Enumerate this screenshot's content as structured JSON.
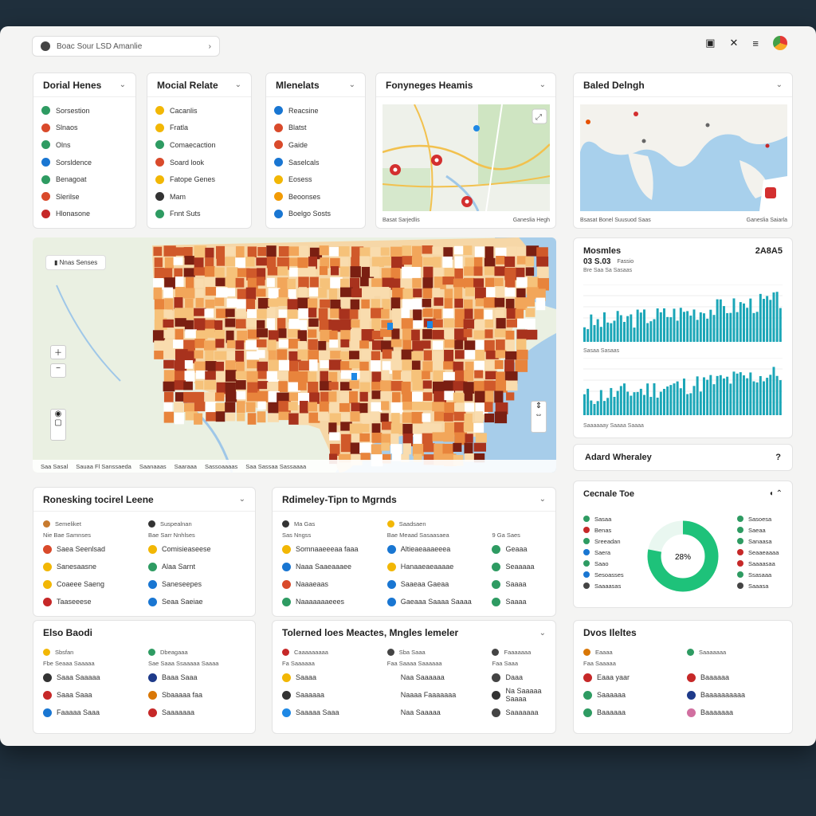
{
  "toolbar": {
    "search_value": "Boac Sour LSD Amanlie"
  },
  "cards": {
    "c1": {
      "title": "Dorial Henes",
      "items": [
        {
          "label": "Sorsestion",
          "color": "#2e9b62"
        },
        {
          "label": "Slnaos",
          "color": "#d94a2b"
        },
        {
          "label": "Olns",
          "color": "#2e9b62"
        },
        {
          "label": "Sorsldence",
          "color": "#1976d2"
        },
        {
          "label": "Benagoat",
          "color": "#2e9b62"
        },
        {
          "label": "Slerilse",
          "color": "#d94a2b"
        },
        {
          "label": "Hlonasone",
          "color": "#c62828"
        }
      ]
    },
    "c2": {
      "title": "Mocial Relate",
      "items": [
        {
          "label": "Cacanlis",
          "color": "#f2b705"
        },
        {
          "label": "Fratla",
          "color": "#f2b705"
        },
        {
          "label": "Comaecaction",
          "color": "#2e9b62"
        },
        {
          "label": "Soard look",
          "color": "#d94a2b"
        },
        {
          "label": "Fatope Genes",
          "color": "#f2b705"
        },
        {
          "label": "Mam",
          "color": "#333"
        },
        {
          "label": "Fnnt Suts",
          "color": "#2e9b62"
        }
      ]
    },
    "c3": {
      "title": "Mlenelats",
      "items": [
        {
          "label": "Reacsine",
          "color": "#1976d2"
        },
        {
          "label": "Blatst",
          "color": "#d94a2b"
        },
        {
          "label": "Gaide",
          "color": "#d94a2b"
        },
        {
          "label": "Saselcals",
          "color": "#1976d2"
        },
        {
          "label": "Eosess",
          "color": "#f2b705"
        },
        {
          "label": "Beoonses",
          "color": "#f29b05"
        },
        {
          "label": "Boelgo Sosts",
          "color": "#1976d2"
        }
      ]
    },
    "c4": {
      "title": "Fonyneges Heamis",
      "footer": "Basat Sarjedlis",
      "footer2": "Ganeslia Hegh"
    },
    "c5": {
      "title": "Baled Delngh",
      "footer": "Bsasat Bonel Suusuod Saas",
      "footer2": "Ganeslia Saiarla"
    }
  },
  "bigmap": {
    "label": "Nnas Senses",
    "footer": [
      "Saa Sasal",
      "Sauaa Fl Sanssaeda",
      "Saanaaas",
      "Saaraaa",
      "Sassoaaaas",
      "Saa Sassaa Sassaaaa"
    ]
  },
  "stats": {
    "title": "Mosmles",
    "value": "2A8A5",
    "sub_value": "03 S.03",
    "sub_label": "Fassio",
    "caption": "Bre Saa Sa Sasaas",
    "caption2": "Sasaa Sasaas",
    "caption3": "Saaaaaay Saaaa Saaaa"
  },
  "alert": {
    "title": "Adard Wheraley",
    "icon": "?"
  },
  "donut": {
    "title": "Cecnale Toe",
    "center": "28%",
    "percent": 0.78,
    "color": "#1ec27a",
    "left": [
      {
        "label": "Sasaa",
        "color": "#2e9b62"
      },
      {
        "label": "Benas",
        "color": "#c62828"
      },
      {
        "label": "Sreeadan",
        "color": "#2e9b62"
      },
      {
        "label": "Saera",
        "color": "#1976d2"
      },
      {
        "label": "Saao",
        "color": "#2e9b62"
      },
      {
        "label": "Sesoasses",
        "color": "#1976d2"
      },
      {
        "label": "Saaaasas",
        "color": "#444"
      }
    ],
    "right": [
      {
        "label": "Sasoesa",
        "color": "#2e9b62"
      },
      {
        "label": "Saeaa",
        "color": "#2e9b62"
      },
      {
        "label": "Sanaasa",
        "color": "#2e9b62"
      },
      {
        "label": "Seaaeaaaa",
        "color": "#c62828"
      },
      {
        "label": "Saaaasaa",
        "color": "#c62828"
      },
      {
        "label": "Ssasaaa",
        "color": "#2e9b62"
      },
      {
        "label": "Saaasa",
        "color": "#444"
      }
    ]
  },
  "section1": {
    "title": "Ronesking tocirel Leene",
    "head_left": "Semeliket",
    "head_left2": "Nie Bae Samnses",
    "head_right": "Suspealnan",
    "head_right2": "Bae Sarr Nnhlses",
    "items": [
      {
        "label": "Saea Seenlsad",
        "color": "#d94a2b"
      },
      {
        "label": "Comisieaseese",
        "color": "#f2b705"
      },
      {
        "label": "Sanesaasne",
        "color": "#f2b705"
      },
      {
        "label": "Alaa Sarnt",
        "color": "#2e9b62"
      },
      {
        "label": "Coaeee Saeng",
        "color": "#f2b705"
      },
      {
        "label": "Saneseepes",
        "color": "#1976d2"
      },
      {
        "label": "Taaseeese",
        "color": "#c62828"
      },
      {
        "label": "Seaa Saeiae",
        "color": "#1976d2"
      }
    ]
  },
  "section2": {
    "title": "Rdimeley-Tipn to Mgrnds",
    "head_a": "Ma Gas",
    "head_a2": "Sas Nngss",
    "head_b": "Saadsaen",
    "head_b2": "Bae Meaad Sasaasaea",
    "head_c": "9 Ga Saes",
    "rows": [
      [
        "Somnaaeeeaa faaa",
        "Altieaeaaaeeea",
        "Geaaa"
      ],
      [
        "Naaa Saaeaaaee",
        "Hanaaeaeaaaae",
        "Seaaaaa"
      ],
      [
        "Naaaeaas",
        "Saaeaa Gaeaa",
        "Saaaa"
      ],
      [
        "Naaaaaaaeees",
        "Gaeaaa Saaaa Saaaa",
        "Saaaa"
      ]
    ],
    "colors": [
      [
        "#f2b705",
        "#1976d2",
        "#2e9b62"
      ],
      [
        "#1976d2",
        "#f2b705",
        "#2e9b62"
      ],
      [
        "#d94a2b",
        "#1976d2",
        "#2e9b62"
      ],
      [
        "#2e9b62",
        "#1976d2",
        "#2e9b62"
      ]
    ]
  },
  "section3": {
    "title": "Elso Baodi",
    "head_left": "Sbsfan",
    "head_left2": "Fbe Seaaa Saaaaa",
    "head_right": "Dbeagaaa",
    "head_right2": "Sae Saaa Ssaaaaa Saaaa",
    "items": [
      {
        "label": "Saaa Saaaaa",
        "color": "#333"
      },
      {
        "label": "Baaa Saaa",
        "color": "#1e3a8a"
      },
      {
        "label": "Saaa Saaa",
        "color": "#c62828"
      },
      {
        "label": "Sbaaaaa faa",
        "color": "#d97706"
      },
      {
        "label": "Faaaaa Saaa",
        "color": "#1976d2"
      },
      {
        "label": "Saaaaaaa",
        "color": "#c62828"
      }
    ]
  },
  "section4": {
    "title": "Tolerned loes Meactes, Mngles lemeler",
    "head_a": "Caaaaaaaaa",
    "head_a2": "Fa Saaaaaa",
    "head_b": "Sba Saaa",
    "head_b2": "Faa Saaaa Saaaaaa",
    "head_c": "Faaaaaaa",
    "head_c2": "Faa Saaa",
    "rows": [
      [
        "Saaaa",
        "Naa Saaaaaa",
        "Daaa"
      ],
      [
        "Saaaaaa",
        "Naaaa Faaaaaaa",
        "Na Saaaaa Saaaa"
      ],
      [
        "Saaaaa Saaa",
        "Naa Saaaaa",
        "Saaaaaaa"
      ]
    ],
    "colors": [
      [
        "#f2b705",
        "",
        "#444"
      ],
      [
        "#333",
        "",
        "#333"
      ],
      [
        "#1e88e5",
        "",
        "#444"
      ]
    ]
  },
  "section5": {
    "title": "Dvos Ileltes",
    "head_left": "Eaaaa",
    "head_left2": "Faa Saaaaa",
    "head_right": "Saaaaaaa",
    "items": [
      {
        "label": "Eaaa yaar",
        "color": "#c62828"
      },
      {
        "label": "Baaaaaa",
        "color": "#c62828"
      },
      {
        "label": "Saaaaaa",
        "color": "#2e9b62"
      },
      {
        "label": "Baaaaaaaaaa",
        "color": "#1e3a8a"
      },
      {
        "label": "Baaaaaa",
        "color": "#2e9b62"
      },
      {
        "label": "Baaaaaaa",
        "color": "#d16fa0"
      }
    ]
  }
}
